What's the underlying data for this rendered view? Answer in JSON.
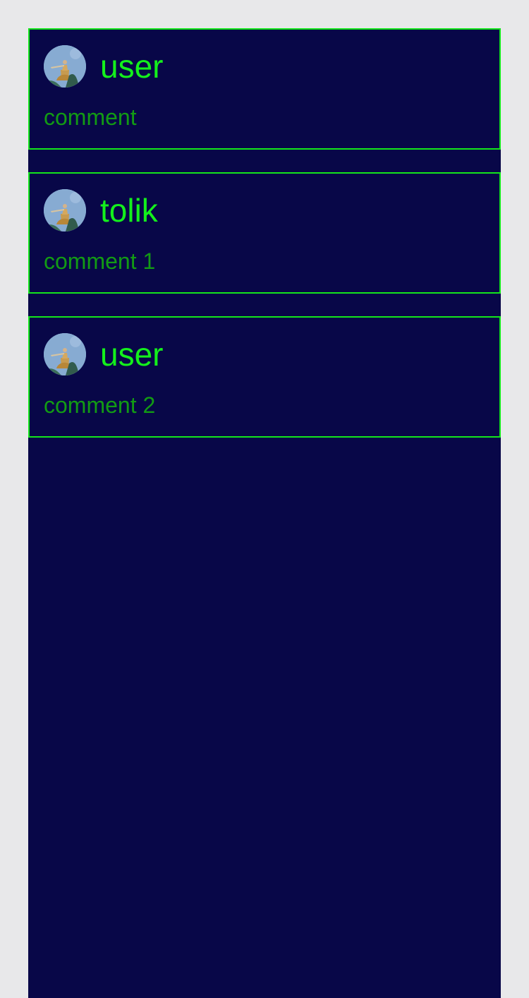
{
  "comments": [
    {
      "username": "user",
      "text": "comment",
      "avatar_icon": "avatar-photo-icon"
    },
    {
      "username": "tolik",
      "text": "comment 1",
      "avatar_icon": "avatar-photo-icon"
    },
    {
      "username": "user",
      "text": "comment 2",
      "avatar_icon": "avatar-photo-icon"
    }
  ],
  "colors": {
    "page_background": "#e8e8ea",
    "panel_background": "#080748",
    "card_border": "#14e61c",
    "username": "#14f01c",
    "comment_text": "#129b14"
  }
}
